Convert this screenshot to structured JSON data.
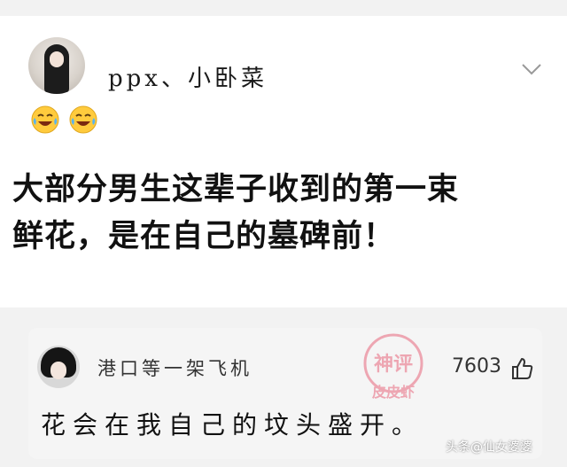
{
  "post": {
    "author": "ppx、小卧菜",
    "emojis": [
      "laughing-crying-emoji",
      "laughing-crying-emoji"
    ],
    "text_line1": "大部分男生这辈子收到的第一束",
    "text_line2": "鲜花，是在自己的墓碑前！"
  },
  "comment": {
    "author": "港口等一架飞机",
    "likes": "7603",
    "text": "花会在我自己的坟头盛开。"
  },
  "watermark": {
    "line1": "神评",
    "line2": "皮皮虾",
    "color": "#e8677d"
  },
  "credit": "头条@仙女婆婆",
  "colors": {
    "background": "#f2f2f2",
    "card": "#ffffff",
    "comment_bg": "#f5f5f5"
  }
}
